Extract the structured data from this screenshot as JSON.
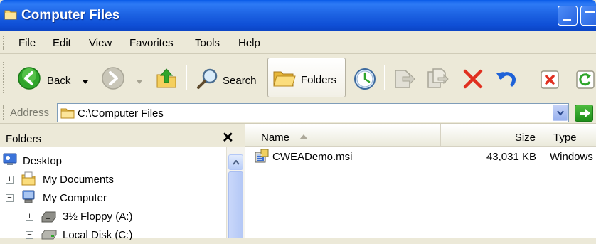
{
  "window": {
    "title": "Computer Files",
    "title_icon": "folder-icon"
  },
  "menu": {
    "items": [
      "File",
      "Edit",
      "View",
      "Favorites",
      "Tools",
      "Help"
    ]
  },
  "toolbar": {
    "back_label": "Back",
    "search_label": "Search",
    "folders_label": "Folders"
  },
  "address": {
    "label": "Address",
    "value": "C:\\Computer Files"
  },
  "folders_pane": {
    "title": "Folders",
    "close_glyph": "✕",
    "tree": [
      {
        "label": "Desktop",
        "icon": "desktop-icon"
      },
      {
        "label": "My Documents",
        "icon": "my-documents-icon",
        "expander": "+"
      },
      {
        "label": "My Computer",
        "icon": "my-computer-icon",
        "expander": "−"
      },
      {
        "label": "3½ Floppy (A:)",
        "icon": "floppy-drive-icon",
        "expander": "+"
      },
      {
        "label": "Local Disk (C:)",
        "icon": "local-disk-icon",
        "expander": "−"
      }
    ]
  },
  "file_list": {
    "columns": {
      "name": "Name",
      "size": "Size",
      "type": "Type"
    },
    "rows": [
      {
        "name": "CWEADemo.msi",
        "size": "43,031 KB",
        "type": "Windows"
      }
    ]
  },
  "colors": {
    "titlebar": "#0F4FD6",
    "chrome": "#ECE9D8",
    "delete_red": "#E03020",
    "undo_blue": "#1E62D8"
  }
}
